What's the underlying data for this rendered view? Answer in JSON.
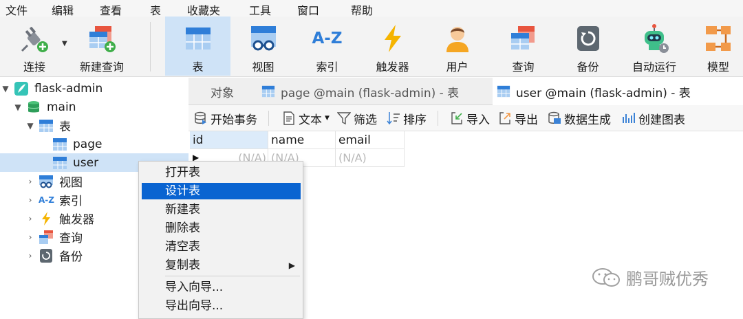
{
  "menubar": {
    "items": [
      "文件",
      "编辑",
      "查看",
      "表",
      "收藏夹",
      "工具",
      "窗口",
      "帮助"
    ]
  },
  "toolbar": {
    "items": [
      {
        "label": "连接",
        "icon": "plug-icon"
      },
      {
        "label": "新建查询",
        "icon": "new-query-icon"
      },
      {
        "label": "表",
        "icon": "table-icon",
        "active": true
      },
      {
        "label": "视图",
        "icon": "view-icon"
      },
      {
        "label": "索引",
        "icon": "index-icon"
      },
      {
        "label": "触发器",
        "icon": "trigger-icon"
      },
      {
        "label": "用户",
        "icon": "user-icon"
      },
      {
        "label": "查询",
        "icon": "query-icon"
      },
      {
        "label": "备份",
        "icon": "backup-icon"
      },
      {
        "label": "自动运行",
        "icon": "robot-icon"
      },
      {
        "label": "模型",
        "icon": "model-icon"
      }
    ],
    "az_text": "A-Z"
  },
  "tree": {
    "connection": "flask-admin",
    "database": "main",
    "tables_label": "表",
    "tables": [
      "page",
      "user"
    ],
    "views_label": "视图",
    "indexes_label": "索引",
    "index_icon_text": "A-Z",
    "triggers_label": "触发器",
    "queries_label": "查询",
    "backups_label": "备份"
  },
  "tabs": [
    {
      "label": "对象"
    },
    {
      "label": "page @main (flask-admin) - 表"
    },
    {
      "label": "user @main (flask-admin) - 表",
      "active": true
    }
  ],
  "subtoolbar": {
    "begin_transaction": "开始事务",
    "text": "文本",
    "filter": "筛选",
    "sort": "排序",
    "import": "导入",
    "export": "导出",
    "data_gen": "数据生成",
    "create_chart": "创建图表"
  },
  "grid": {
    "columns": [
      "id",
      "name",
      "email"
    ],
    "row": [
      "(N/A)",
      "(N/A)",
      "(N/A)"
    ]
  },
  "context_menu": {
    "items": [
      "打开表",
      "设计表",
      "新建表",
      "删除表",
      "清空表",
      "复制表",
      "导入向导...",
      "导出向导..."
    ],
    "highlighted": "设计表",
    "submenu_arrow": "▶"
  },
  "watermark": "鹏哥贼优秀",
  "colors": {
    "accent": "#0a64d1",
    "selected_bg": "#cfe3f7",
    "table_blue": "#2f7ed8",
    "db_green": "#2e9e5a",
    "trigger_yellow": "#f5b400",
    "plus_green": "#3fae4a"
  }
}
